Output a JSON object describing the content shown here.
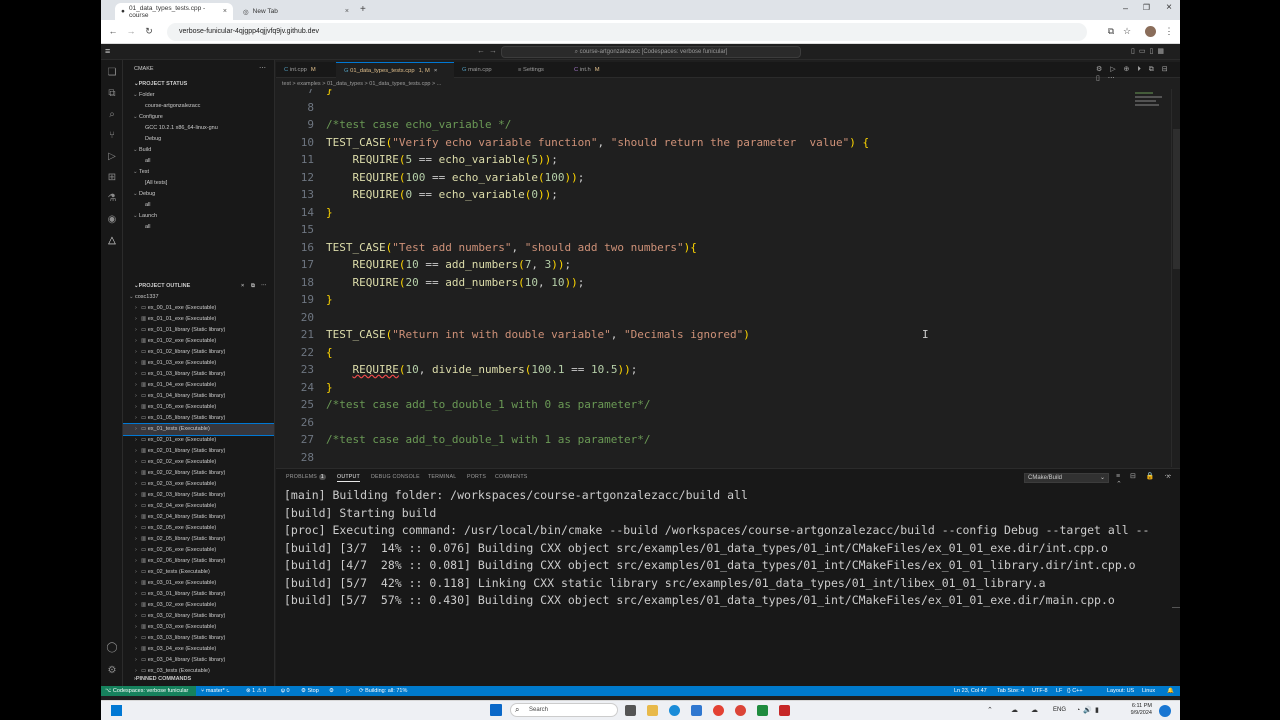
{
  "browser": {
    "tabs": [
      {
        "title": "01_data_types_tests.cpp - course",
        "active": true
      },
      {
        "title": "New Tab",
        "active": false
      }
    ],
    "url": "verbose-funicular-4qjgpp4qjjvfq9jv.github.dev",
    "command_center": "course-artgonzalezacc [Codespaces: verbose funicular]"
  },
  "sidebar": {
    "title": "CMAKE",
    "project_status": "PROJECT STATUS",
    "status_tree": [
      {
        "label": "Folder",
        "indent": 1
      },
      {
        "label": "course-artgonzalezacc",
        "indent": 2
      },
      {
        "label": "Configure",
        "indent": 1
      },
      {
        "label": "GCC 10.2.1 x86_64-linux-gnu",
        "indent": 2
      },
      {
        "label": "Debug",
        "indent": 2
      },
      {
        "label": "Build",
        "indent": 1
      },
      {
        "label": "all",
        "indent": 2
      },
      {
        "label": "Test",
        "indent": 1
      },
      {
        "label": "[All tests]",
        "indent": 2
      },
      {
        "label": "Debug",
        "indent": 1
      },
      {
        "label": "all",
        "indent": 2
      },
      {
        "label": "Launch",
        "indent": 1
      },
      {
        "label": "all",
        "indent": 2
      }
    ],
    "project_outline": "PROJECT OUTLINE",
    "outline_root": "cosc1337",
    "targets": [
      "ex_00_01_exe (Executable)",
      "ex_01_01_exe (Executable)",
      "ex_01_01_library (Static library)",
      "ex_01_02_exe (Executable)",
      "ex_01_02_library (Static library)",
      "ex_01_03_exe (Executable)",
      "ex_01_03_library (Static library)",
      "ex_01_04_exe (Executable)",
      "ex_01_04_library (Static library)",
      "ex_01_05_exe (Executable)",
      "ex_01_05_library (Static library)",
      "ex_01_tests (Executable)",
      "ex_02_01_exe (Executable)",
      "ex_02_01_library (Static library)",
      "ex_02_02_exe (Executable)",
      "ex_02_02_library (Static library)",
      "ex_02_03_exe (Executable)",
      "ex_02_03_library (Static library)",
      "ex_02_04_exe (Executable)",
      "ex_02_04_library (Static library)",
      "ex_02_05_exe (Executable)",
      "ex_02_05_library (Static library)",
      "ex_02_06_exe (Executable)",
      "ex_02_06_library (Static library)",
      "ex_02_tests (Executable)",
      "ex_03_01_exe (Executable)",
      "ex_03_01_library (Static library)",
      "ex_03_02_exe (Executable)",
      "ex_03_02_library (Static library)",
      "ex_03_03_exe (Executable)",
      "ex_03_03_library (Static library)",
      "ex_03_04_exe (Executable)",
      "ex_03_04_library (Static library)",
      "ex_03_tests (Executable)"
    ],
    "pinned": "PINNED COMMANDS"
  },
  "editor": {
    "tabs": [
      {
        "label": "int.cpp",
        "badge": "M"
      },
      {
        "label": "01_data_types_tests.cpp",
        "badge": "1, M"
      },
      {
        "label": "main.cpp",
        "badge": ""
      },
      {
        "label": "Settings",
        "badge": ""
      },
      {
        "label": "int.h",
        "badge": "M"
      }
    ],
    "breadcrumb": "test  >  examples  >  01_data_types  >  01_data_types_tests.cpp  >  ...",
    "lines": [
      {
        "n": "7",
        "text": "}"
      },
      {
        "n": "8",
        "text": ""
      },
      {
        "n": "9",
        "text": "/*test case echo_variable */"
      },
      {
        "n": "10",
        "text": "TEST_CASE(\"Verify echo variable function\", \"should return the parameter  value\") {"
      },
      {
        "n": "11",
        "text": "    REQUIRE(5 == echo_variable(5));"
      },
      {
        "n": "12",
        "text": "    REQUIRE(100 == echo_variable(100));"
      },
      {
        "n": "13",
        "text": "    REQUIRE(0 == echo_variable(0));"
      },
      {
        "n": "14",
        "text": "}"
      },
      {
        "n": "15",
        "text": ""
      },
      {
        "n": "16",
        "text": "TEST_CASE(\"Test add numbers\", \"should add two numbers\"){"
      },
      {
        "n": "17",
        "text": "    REQUIRE(10 == add_numbers(7, 3));"
      },
      {
        "n": "18",
        "text": "    REQUIRE(20 == add_numbers(10, 10));"
      },
      {
        "n": "19",
        "text": "}"
      },
      {
        "n": "20",
        "text": ""
      },
      {
        "n": "21",
        "text": "TEST_CASE(\"Return int with double variable\", \"Decimals ignored\")"
      },
      {
        "n": "22",
        "text": "{"
      },
      {
        "n": "23",
        "text": "    REQUIRE(10, divide_numbers(100.1 == 10.5));"
      },
      {
        "n": "24",
        "text": "}"
      },
      {
        "n": "25",
        "text": "/*test case add_to_double_1 with 0 as parameter*/"
      },
      {
        "n": "26",
        "text": ""
      },
      {
        "n": "27",
        "text": "/*test case add_to_double_1 with 1 as parameter*/"
      },
      {
        "n": "28",
        "text": ""
      }
    ]
  },
  "panel": {
    "tabs": [
      "PROBLEMS",
      "OUTPUT",
      "DEBUG CONSOLE",
      "TERMINAL",
      "PORTS",
      "COMMENTS"
    ],
    "problems_count": "1",
    "active_tab": "OUTPUT",
    "channel": "CMake/Build",
    "output": [
      "[main] Building folder: /workspaces/course-artgonzalezacc/build all",
      "[build] Starting build",
      "[proc] Executing command: /usr/local/bin/cmake --build /workspaces/course-artgonzalezacc/build --config Debug --target all --",
      "[build] [3/7  14% :: 0.076] Building CXX object src/examples/01_data_types/01_int/CMakeFiles/ex_01_01_exe.dir/int.cpp.o",
      "[build] [4/7  28% :: 0.081] Building CXX object src/examples/01_data_types/01_int/CMakeFiles/ex_01_01_library.dir/int.cpp.o",
      "[build] [5/7  42% :: 0.118] Linking CXX static library src/examples/01_data_types/01_int/libex_01_01_library.a",
      "[build] [5/7  57% :: 0.430] Building CXX object src/examples/01_data_types/01_int/CMakeFiles/ex_01_01_exe.dir/main.cpp.o"
    ]
  },
  "statusbar": {
    "remote": "Codespaces: verbose funicular",
    "branch": "master*",
    "problems": "⊗ 1 ⚠ 0",
    "ports": "0",
    "stop": "Stop",
    "building": "Building: all: 71%",
    "position": "Ln 23, Col 47",
    "tab_size": "Tab Size: 4",
    "encoding": "UTF-8",
    "eol": "LF",
    "language": "C++",
    "layout": "Layout: US",
    "platform": "Linux"
  },
  "taskbar": {
    "search_placeholder": "Search",
    "lang": "ENG",
    "time": "6:11 PM",
    "date": "9/9/2024"
  },
  "colors": {
    "status_blue": "#007acc",
    "remote_green": "#16825d",
    "comment": "#6a9955",
    "string": "#ce9178"
  }
}
